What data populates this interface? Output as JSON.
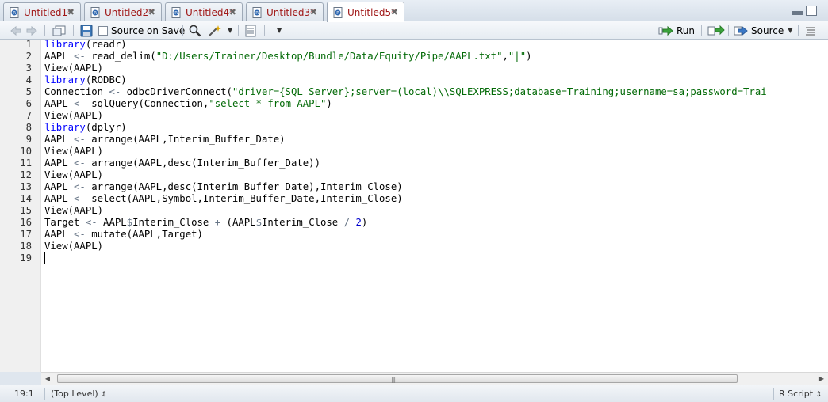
{
  "tabs": [
    {
      "label": "Untitled1*",
      "active": false
    },
    {
      "label": "Untitled2*",
      "active": false
    },
    {
      "label": "Untitled4*",
      "active": false
    },
    {
      "label": "Untitled3*",
      "active": false
    },
    {
      "label": "Untitled5*",
      "active": true
    }
  ],
  "toolbar": {
    "source_on_save_label": "Source on Save",
    "run_label": "Run",
    "source_label": "Source"
  },
  "code_lines": [
    "library(readr)",
    "AAPL <- read_delim(\"D:/Users/Trainer/Desktop/Bundle/Data/Equity/Pipe/AAPL.txt\",\"|\")",
    "View(AAPL)",
    "library(RODBC)",
    "Connection <- odbcDriverConnect(\"driver={SQL Server};server=(local)\\\\SQLEXPRESS;database=Training;username=sa;password=Trai",
    "AAPL <- sqlQuery(Connection,\"select * from AAPL\")",
    "View(AAPL)",
    "library(dplyr)",
    "AAPL <- arrange(AAPL,Interim_Buffer_Date)",
    "View(AAPL)",
    "AAPL <- arrange(AAPL,desc(Interim_Buffer_Date))",
    "View(AAPL)",
    "AAPL <- arrange(AAPL,desc(Interim_Buffer_Date),Interim_Close)",
    "AAPL <- select(AAPL,Symbol,Interim_Buffer_Date,Interim_Close)",
    "View(AAPL)",
    "Target <- AAPL$Interim_Close + (AAPL$Interim_Close / 2)",
    "AAPL <- mutate(AAPL,Target)",
    "View(AAPL)",
    ""
  ],
  "status": {
    "cursor_position": "19:1",
    "scope": "(Top Level)",
    "file_type": "R Script"
  },
  "colors": {
    "keyword": "#0000ff",
    "string": "#036a07",
    "operator": "#687687",
    "number": "#0000cd",
    "tab_text": "#a01818"
  }
}
